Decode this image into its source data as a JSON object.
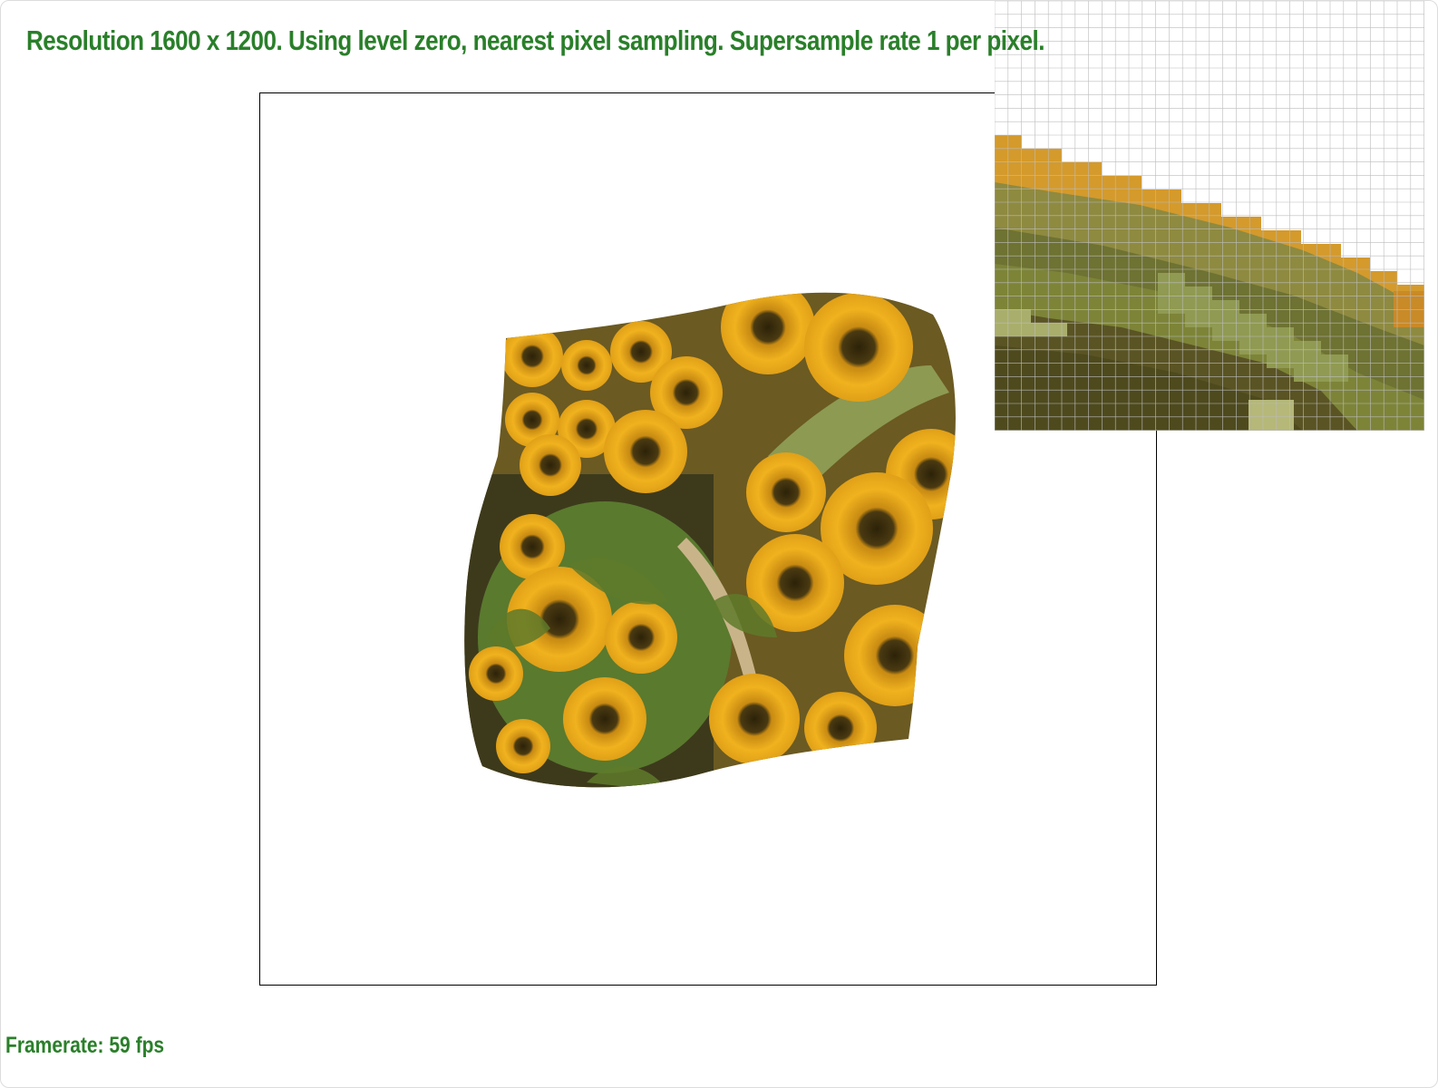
{
  "app": {
    "status_text": "Resolution 1600 x 1200. Using level zero, nearest pixel sampling. Supersample rate 1 per pixel.",
    "framerate_text": "Framerate: 59 fps"
  },
  "colors": {
    "hud_text": "#2a7f2a",
    "canvas_border": "#000000",
    "zoom_grid": "#bcbcbc",
    "petal_gold": "#d89a2a",
    "petal_orange": "#c47f18",
    "leaf_green": "#6e7a34",
    "stem_light": "#a9b06a",
    "disk_dark": "#3a2e10"
  },
  "icons": {
    "zoom_panel": "pixel-inspector-zoom"
  }
}
